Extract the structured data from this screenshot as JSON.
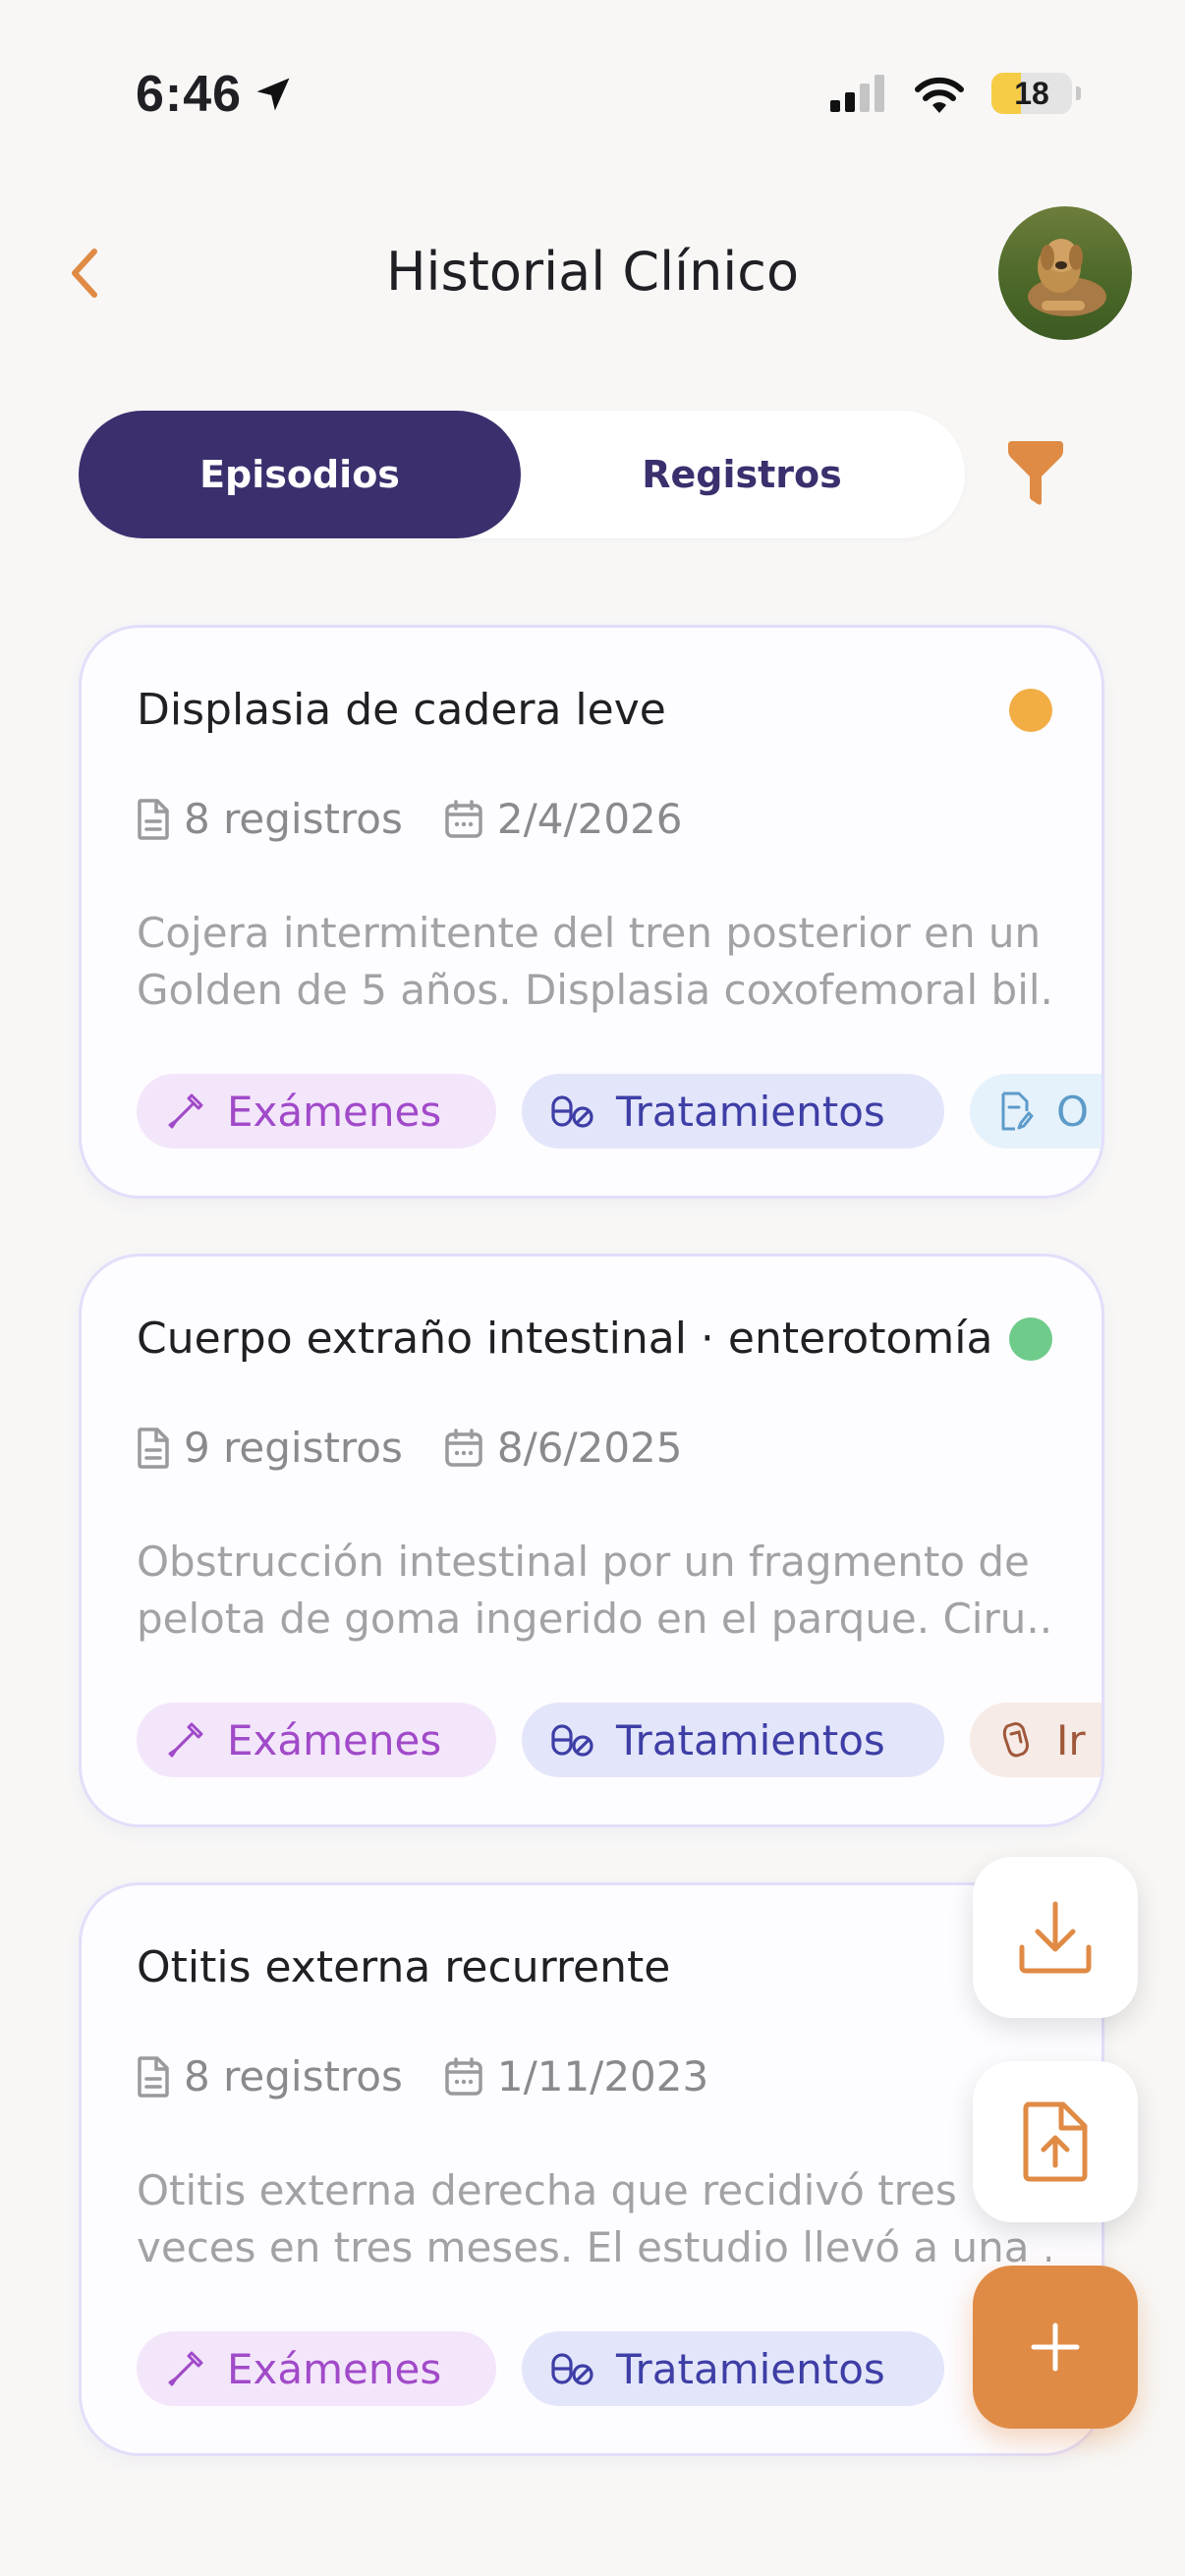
{
  "status_bar": {
    "time": "6:46",
    "battery": "18"
  },
  "header": {
    "title": "Historial Clínico"
  },
  "tabs": [
    {
      "label": "Episodios",
      "active": true
    },
    {
      "label": "Registros",
      "active": false
    }
  ],
  "episodes": [
    {
      "title": "Displasia de cadera leve",
      "status_color": "#f2ad44",
      "records": "8 registros",
      "date": "2/4/2026",
      "description_lines": [
        "Cojera intermitente del tren posterior en un",
        "Golden de 5 años. Displasia coxofemoral bil..."
      ],
      "chips": [
        "Exámenes",
        "Tratamientos",
        "O"
      ]
    },
    {
      "title": "Cuerpo extraño intestinal · enterotomía",
      "status_color": "#6fcb8a",
      "records": "9 registros",
      "date": "8/6/2025",
      "description_lines": [
        "Obstrucción intestinal por un fragmento de",
        "pelota de goma ingerido en el parque. Ciru..."
      ],
      "chips": [
        "Exámenes",
        "Tratamientos",
        "Ir"
      ]
    },
    {
      "title": "Otitis externa recurrente",
      "records": "8 registros",
      "date": "1/11/2023",
      "description_lines": [
        "Otitis externa derecha que recidivó tres",
        "veces en tres meses. El estudio llevó a una ..."
      ],
      "chips": [
        "Exámenes",
        "Tratamientos"
      ]
    }
  ],
  "colors": {
    "accent": "#e08b45",
    "primary": "#3b2f6e",
    "background": "#f8f7f6"
  }
}
